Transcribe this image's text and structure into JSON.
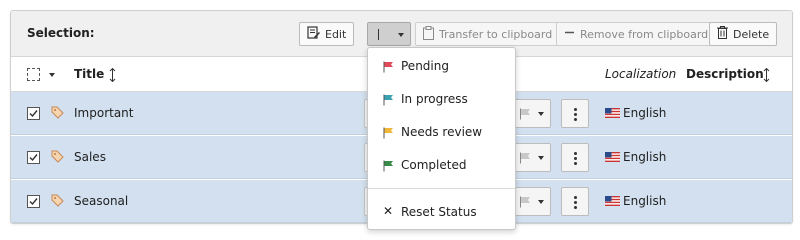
{
  "toolbar": {
    "selection_label": "Selection:",
    "edit_label": "Edit",
    "transfer_label": "Transfer to clipboard",
    "remove_label": "Remove from clipboard",
    "delete_label": "Delete"
  },
  "table": {
    "headers": {
      "title": "Title",
      "localization": "Localization",
      "description": "Description"
    },
    "rows": [
      {
        "title": "Important",
        "language": "English",
        "selected": true
      },
      {
        "title": "Sales",
        "language": "English",
        "selected": true
      },
      {
        "title": "Seasonal",
        "language": "English",
        "selected": true
      }
    ]
  },
  "status_menu": {
    "items": [
      {
        "label": "Pending",
        "color": "#e04a5a"
      },
      {
        "label": "In progress",
        "color": "#3aa2b0"
      },
      {
        "label": "Needs review",
        "color": "#f0b63a"
      },
      {
        "label": "Completed",
        "color": "#3a8a4a"
      }
    ],
    "reset": {
      "label": "Reset Status",
      "icon": "close-icon"
    }
  },
  "colors": {
    "selected_row": "#d2e0ef",
    "toolbar_bg": "#f0f0f0"
  }
}
